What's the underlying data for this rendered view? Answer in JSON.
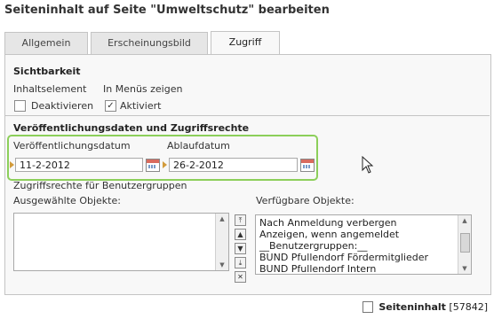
{
  "page": {
    "title": "Seiteninhalt auf Seite \"Umweltschutz\" bearbeiten"
  },
  "tabs": [
    {
      "label": "Allgemein"
    },
    {
      "label": "Erscheinungsbild"
    },
    {
      "label": "Zugriff",
      "active": true
    }
  ],
  "visibility": {
    "heading": "Sichtbarkeit",
    "content_element_label": "Inhaltselement",
    "menus_label": "In Menüs zeigen",
    "deactivate_label": "Deaktivieren",
    "deactivate_checked": false,
    "activated_label": "Aktiviert",
    "activated_checked": true
  },
  "publication": {
    "heading": "Veröffentlichungsdaten und Zugriffsrechte",
    "pub_date_label": "Veröffentlichungsdatum",
    "pub_date_value": "11-2-2012",
    "exp_date_label": "Ablaufdatum",
    "exp_date_value": "26-2-2012",
    "access_rights_label": "Zugriffsrechte für Benutzergruppen",
    "selected_label": "Ausgewählte Objekte:",
    "available_label": "Verfügbare Objekte:",
    "available_items": [
      "Nach Anmeldung verbergen",
      "Anzeigen, wenn angemeldet",
      "__Benutzergruppen:__",
      "BUND Pfullendorf Fördermitglieder",
      "BUND Pfullendorf Intern"
    ]
  },
  "footer": {
    "record_label": "Seiteninhalt",
    "record_id": "[57842]"
  },
  "colors": {
    "highlight": "#8ccf5a",
    "panel": "#f8f8f8",
    "border": "#c4c4c4"
  },
  "icons": [
    "calendar-icon",
    "document-icon",
    "move-up-icon",
    "move-down-icon",
    "move-top-icon",
    "move-bottom-icon",
    "remove-icon",
    "mouse-cursor-icon"
  ]
}
